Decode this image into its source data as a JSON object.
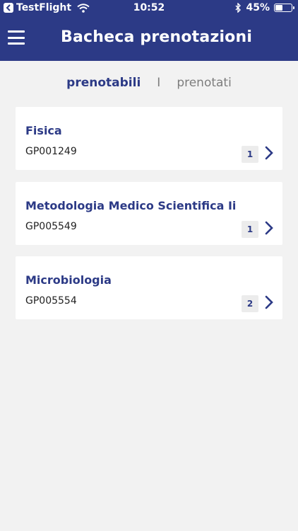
{
  "status_bar": {
    "back_app": "TestFlight",
    "time": "10:52",
    "battery": "45%",
    "battery_level": 0.45
  },
  "header": {
    "title": "Bacheca prenotazioni"
  },
  "tabs": {
    "active": "prenotabili",
    "separator": "I",
    "inactive": "prenotati"
  },
  "cards": [
    {
      "title": "Fisica",
      "code": "GP001249",
      "count": "1"
    },
    {
      "title": "Metodologia Medico Scientifica Ii",
      "code": "GP005549",
      "count": "1"
    },
    {
      "title": "Microbiologia",
      "code": "GP005554",
      "count": "2"
    }
  ],
  "colors": {
    "primary": "#2c3a86",
    "background": "#f2f2f2",
    "card": "#ffffff",
    "badge": "#ececec"
  },
  "icons": [
    "back-icon",
    "wifi-icon",
    "bluetooth-icon",
    "battery-icon",
    "menu-icon",
    "chevron-right-icon"
  ]
}
